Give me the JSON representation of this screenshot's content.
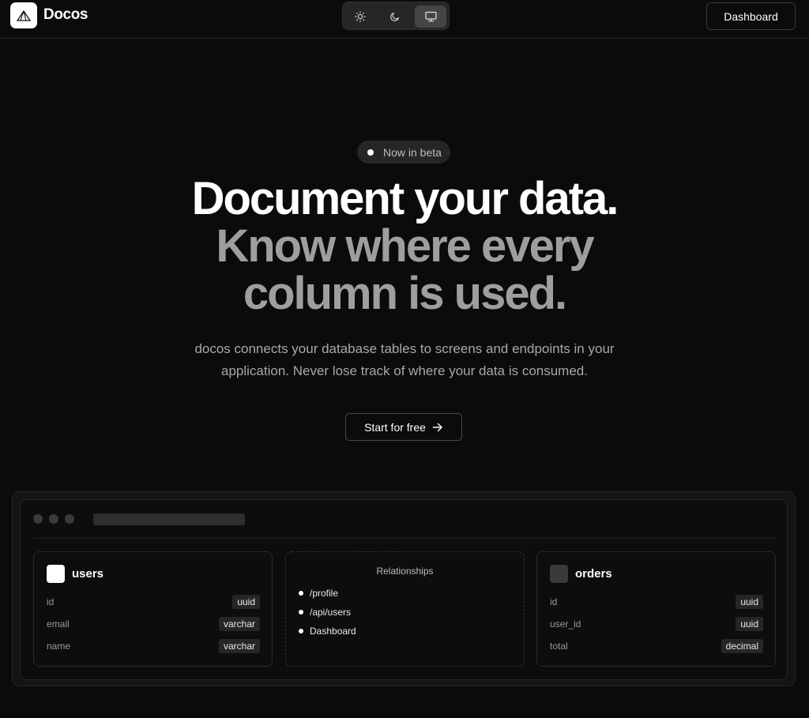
{
  "brand": {
    "name": "Docos",
    "logo_icon": "triangle-logo-icon"
  },
  "theme_switch": {
    "options": [
      {
        "name": "light",
        "icon": "sun-icon",
        "active": false
      },
      {
        "name": "dark",
        "icon": "moon-icon",
        "active": false
      },
      {
        "name": "system",
        "icon": "monitor-icon",
        "active": true
      }
    ]
  },
  "header": {
    "dashboard_label": "Dashboard"
  },
  "hero": {
    "badge": "Now in beta",
    "headline_line1": "Document your data.",
    "headline_line2": "Know where every",
    "headline_line3": "column is used.",
    "subtext_line1": "docos connects your database tables to screens and endpoints in your",
    "subtext_line2": "application. Never lose track of where your data is consumed.",
    "cta_label": "Start for free",
    "cta_icon": "arrow-right-icon"
  },
  "preview": {
    "users": {
      "title": "users",
      "columns": [
        {
          "key": "id",
          "type": "uuid"
        },
        {
          "key": "email",
          "type": "varchar"
        },
        {
          "key": "name",
          "type": "varchar"
        }
      ]
    },
    "relationships": {
      "title": "Relationships",
      "items": [
        "/profile",
        "/api/users",
        "Dashboard"
      ]
    },
    "orders": {
      "title": "orders",
      "columns": [
        {
          "key": "id",
          "type": "uuid"
        },
        {
          "key": "user_id",
          "type": "uuid"
        },
        {
          "key": "total",
          "type": "decimal"
        }
      ]
    }
  },
  "colors": {
    "background": "#0b0b0b",
    "headline_primary": "#ffffff",
    "headline_secondary": "#9e9e9e",
    "muted_text": "#a8a8a8"
  }
}
